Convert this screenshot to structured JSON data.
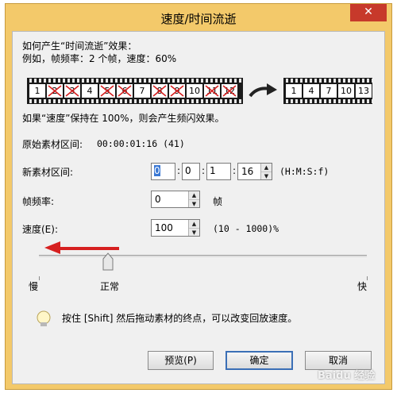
{
  "window": {
    "title": "速度/时间流逝",
    "close": "✕"
  },
  "intro": {
    "line1": "如何产生“时间流逝”效果：",
    "line2": "例如，帧频率：2 个帧，速度：60%"
  },
  "film_before": {
    "frames": [
      "1",
      "2",
      "3",
      "4",
      "5",
      "6",
      "7",
      "8",
      "9",
      "10",
      "11",
      "12"
    ],
    "crossed": [
      "2",
      "3",
      "5",
      "6",
      "8",
      "9",
      "11",
      "12"
    ]
  },
  "film_after": {
    "frames": [
      "1",
      "4",
      "7",
      "10",
      "13"
    ]
  },
  "notes": {
    "flicker": "如果“速度”保持在 100%，则会产生频闪效果。"
  },
  "original_range": {
    "label": "原始素材区间:",
    "value": "00:00:01:16 (41)"
  },
  "new_range": {
    "label": "新素材区间:",
    "h": "0",
    "m": "0",
    "s": "1",
    "f": "16",
    "sep": ":",
    "format": "(H:M:S:f)"
  },
  "frame_rate": {
    "label": "帧频率:",
    "value": "0",
    "unit": "帧"
  },
  "speed": {
    "label": "速度(E):",
    "value": "100",
    "range": "(10 - 1000)%",
    "level": 0.21
  },
  "slider_labels": {
    "slow": "慢",
    "normal": "正常",
    "fast": "快"
  },
  "tip": {
    "text": "按住 [Shift] 然后拖动素材的终点，可以改变回放速度。"
  },
  "buttons": {
    "preview": "预览(P)",
    "ok": "确定",
    "cancel": "取消"
  },
  "watermark": "Baidu 经验",
  "colors": {
    "title_bg": "#f3c96a",
    "close_bg": "#c7392b",
    "arrow_red": "#d62020",
    "default_border": "#3b6fb6"
  }
}
